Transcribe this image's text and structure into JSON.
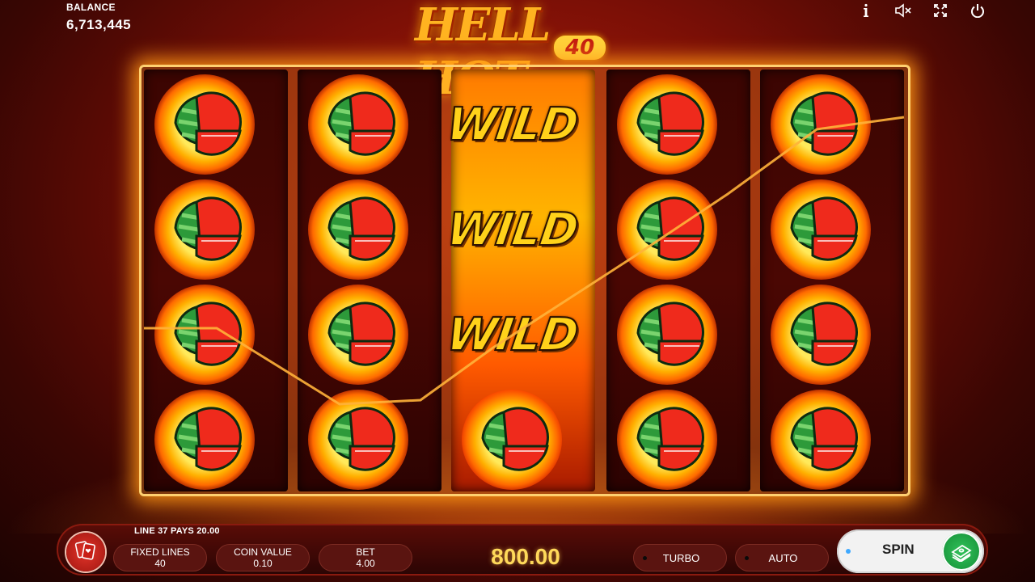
{
  "header": {
    "balance_label": "BALANCE",
    "balance_value": "6,713,445",
    "icons": [
      "info-icon",
      "sound-muted-icon",
      "fullscreen-icon",
      "power-icon"
    ]
  },
  "logo": {
    "title": "HELL HOT",
    "subtitle": "40"
  },
  "reels": {
    "columns": [
      [
        "watermelon",
        "watermelon",
        "watermelon",
        "watermelon"
      ],
      [
        "watermelon",
        "watermelon",
        "watermelon",
        "watermelon"
      ],
      [
        "WILD",
        "WILD",
        "WILD",
        "watermelon"
      ],
      [
        "watermelon",
        "watermelon",
        "watermelon",
        "watermelon"
      ],
      [
        "watermelon",
        "watermelon",
        "watermelon",
        "watermelon"
      ]
    ],
    "wild_text": "WILD"
  },
  "bottom_bar": {
    "win_message": "LINE 37 PAYS 20.00",
    "fixed_lines_label": "FIXED LINES",
    "fixed_lines_value": "40",
    "coin_value_label": "COIN VALUE",
    "coin_value_value": "0.10",
    "bet_label": "BET",
    "bet_value": "4.00",
    "win_amount": "800.00",
    "turbo_label": "TURBO",
    "auto_label": "AUTO",
    "spin_label": "SPIN"
  },
  "colors": {
    "accent_gold": "#ffd95a",
    "spin_green": "#31c25a",
    "background_red": "#7a0f06"
  }
}
